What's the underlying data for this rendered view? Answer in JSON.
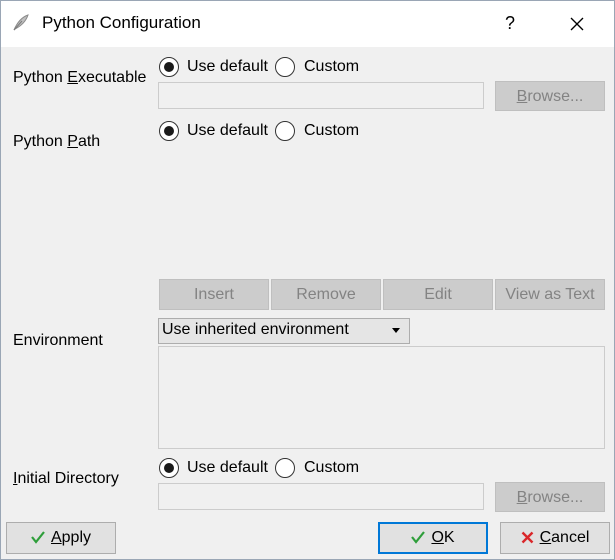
{
  "window": {
    "title": "Python Configuration",
    "help_label": "?"
  },
  "python_executable": {
    "label_pre": "Python ",
    "label_accel": "E",
    "label_post": "xecutable",
    "option_default": "Use default",
    "option_custom": "Custom",
    "selected": "default",
    "path_value": "",
    "browse_label_accel": "B",
    "browse_label_post": "rowse..."
  },
  "python_path": {
    "label_pre": "Python ",
    "label_accel": "P",
    "label_post": "ath",
    "option_default": "Use default",
    "option_custom": "Custom",
    "selected": "default",
    "buttons": {
      "insert": "Insert",
      "remove": "Remove",
      "edit": "Edit",
      "view_as_text": "View as Text"
    }
  },
  "environment": {
    "label": "Environment",
    "selected_option": "Use inherited environment",
    "text_value": ""
  },
  "initial_directory": {
    "label_accel": "I",
    "label_post": "nitial Directory",
    "option_default": "Use default",
    "option_custom": "Custom",
    "selected": "default",
    "path_value": "",
    "browse_label_accel": "B",
    "browse_label_post": "rowse..."
  },
  "footer": {
    "apply_accel": "A",
    "apply_post": "pply",
    "ok_accel": "O",
    "ok_post": "K",
    "cancel_accel": "C",
    "cancel_post": "ancel"
  },
  "colors": {
    "check_green": "#2e9e3a",
    "cancel_red": "#d9262a",
    "focus_blue": "#0078d7"
  }
}
